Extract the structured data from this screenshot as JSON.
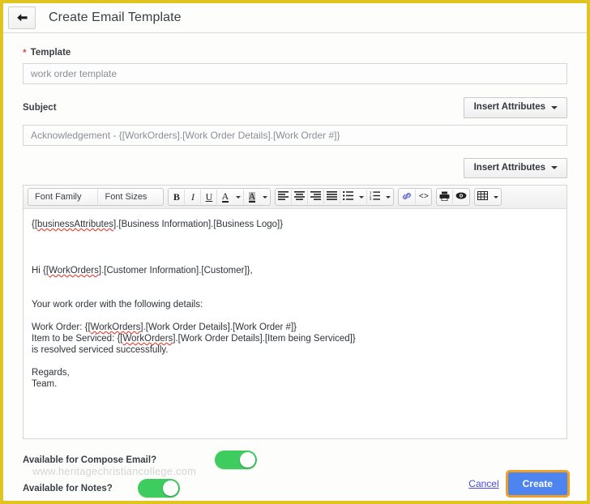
{
  "window": {
    "frame_color": "#e0c521",
    "title": "Create Email Template",
    "back_icon": "back-arrow-icon"
  },
  "form": {
    "template": {
      "label": "Template",
      "required_marker": "*",
      "value": "work order template",
      "placeholder": "work order template"
    },
    "subject": {
      "label": "Subject",
      "value": "Acknowledgement - {[WorkOrders].[Work Order Details].[Work Order #]}",
      "placeholder": "Acknowledgement - {[WorkOrders].[Work Order Details].[Work Order #]}"
    },
    "insert_attributes_subject": "Insert Attributes",
    "insert_attributes_body": "Insert Attributes"
  },
  "editor": {
    "toolbar": {
      "font_family": "Font Family",
      "font_sizes": "Font Sizes",
      "bold": "B",
      "italic": "I",
      "underline": "U",
      "text_color": "A",
      "background_color": "A",
      "align_left": "align-left-icon",
      "align_center": "align-center-icon",
      "align_right": "align-right-icon",
      "align_justify": "align-justify-icon",
      "bullet_list": "bullet-list-icon",
      "numbered_list": "numbered-list-icon",
      "link": "link-icon",
      "source_code": "<>",
      "print": "print-icon",
      "preview": "preview-eye-icon",
      "table": "table-icon"
    },
    "content": {
      "line_logo_pre": "{[",
      "line_logo_misspell": "businessAttributes",
      "line_logo_post": "].[Business Information].[Business Logo]}",
      "line_greeting_pre": "Hi {[",
      "line_greeting_misspell": "WorkOrders",
      "line_greeting_post": "].[Customer Information].[Customer]},",
      "line_intro": "Your work order with the following details:",
      "line_wo_pre": "Work Order: {[",
      "line_wo_misspell": "WorkOrders",
      "line_wo_post": "].[Work Order Details].[Work Order #]}",
      "line_item_pre": "Item to be Serviced: {[",
      "line_item_misspell": "WorkOrders",
      "line_item_post": "].[Work Order Details].[Item being Serviced]}",
      "line_resolved": "is resolved serviced successfully.",
      "line_regards": "Regards,",
      "line_team": "Team."
    }
  },
  "toggles": [
    {
      "label": "Available for Compose Email?",
      "state": "on"
    },
    {
      "label": "Available for Notes?",
      "state": "on"
    }
  ],
  "watermark": "www.heritagechristiancollege.com",
  "footer": {
    "cancel_label": "Cancel",
    "create_label": "Create",
    "create_color": "#4d84f0",
    "focus_ring_color": "#f0a022"
  }
}
